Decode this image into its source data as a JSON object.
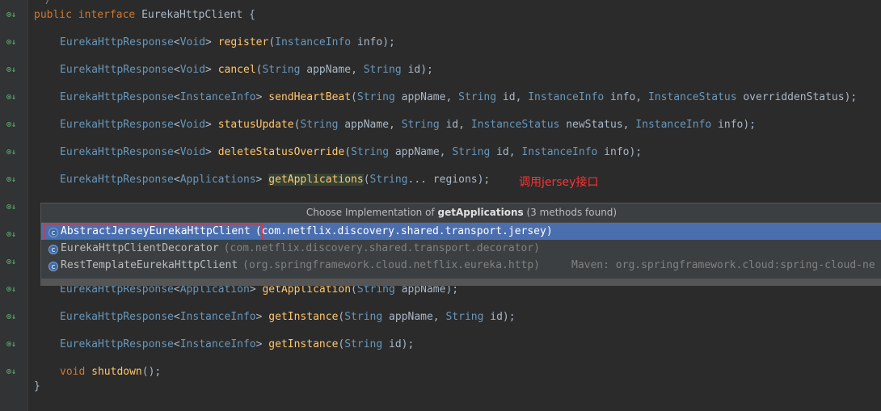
{
  "code": {
    "top_comment": "*/",
    "decl": {
      "kw1": "public",
      "kw2": "interface",
      "name": "EurekaHttpClient",
      "brace": "{"
    },
    "lines": [
      {
        "ret": "EurekaHttpResponse",
        "gen": "Void",
        "method": "register",
        "params": "InstanceInfo info"
      },
      {
        "ret": "EurekaHttpResponse",
        "gen": "Void",
        "method": "cancel",
        "params": "String appName, String id"
      },
      {
        "ret": "EurekaHttpResponse",
        "gen": "InstanceInfo",
        "method": "sendHeartBeat",
        "params": "String appName, String id, InstanceInfo info, InstanceStatus overriddenStatus"
      },
      {
        "ret": "EurekaHttpResponse",
        "gen": "Void",
        "method": "statusUpdate",
        "params": "String appName, String id, InstanceStatus newStatus, InstanceInfo info"
      },
      {
        "ret": "EurekaHttpResponse",
        "gen": "Void",
        "method": "deleteStatusOverride",
        "params": "String appName, String id, InstanceInfo info"
      },
      {
        "ret": "EurekaHttpResponse",
        "gen": "Applications",
        "method": "getApplications",
        "params": "String... regions"
      }
    ],
    "lines_after": [
      {
        "ret": "EurekaHttpResponse",
        "gen": "Application",
        "method": "getApplication",
        "params": "String appName"
      },
      {
        "ret": "EurekaHttpResponse",
        "gen": "InstanceInfo",
        "method": "getInstance",
        "params": "String appName, String id"
      },
      {
        "ret": "EurekaHttpResponse",
        "gen": "InstanceInfo",
        "method": "getInstance",
        "params": "String id"
      }
    ],
    "void_line": {
      "kw": "void",
      "method": "shutdown"
    },
    "close_brace": "}"
  },
  "annotation": "调用jersey接口",
  "popup": {
    "title_prefix": "Choose Implementation of",
    "title_method": "getApplications",
    "title_suffix": "(3 methods found)",
    "items": [
      {
        "name": "AbstractJerseyEurekaHttpClient",
        "pkg": "(com.netflix.discovery.shared.transport.jersey)",
        "selected": true
      },
      {
        "name": "EurekaHttpClientDecorator",
        "pkg": "(com.netflix.discovery.shared.transport.decorator)",
        "selected": false
      },
      {
        "name": "RestTemplateEurekaHttpClient",
        "pkg": "(org.springframework.cloud.netflix.eureka.http)",
        "selected": false
      }
    ],
    "maven_text": "Maven: org.springframework.cloud:spring-cloud-ne"
  },
  "colors": {
    "background": "#2b2b2b",
    "keyword": "#cc7832",
    "method": "#ffc66d",
    "type": "#6897bb",
    "selection": "#4b6eaf",
    "annotation": "#ff3333"
  }
}
